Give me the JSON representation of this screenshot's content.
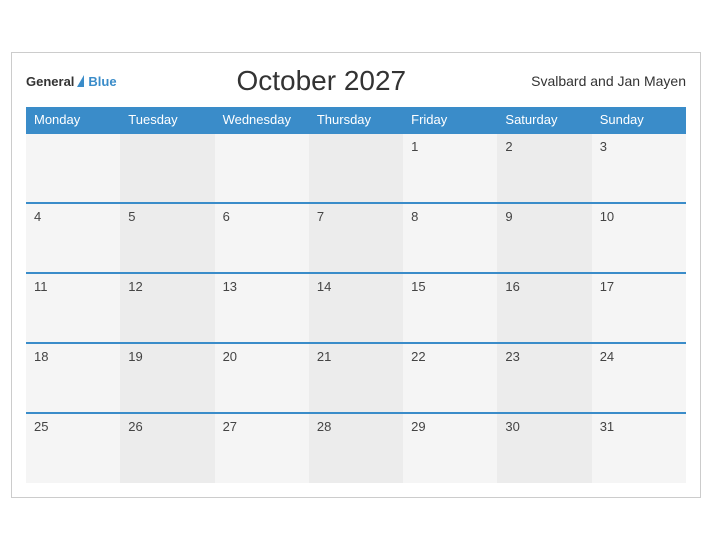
{
  "header": {
    "logo_general": "General",
    "logo_blue": "Blue",
    "title": "October 2027",
    "region": "Svalbard and Jan Mayen"
  },
  "weekdays": [
    "Monday",
    "Tuesday",
    "Wednesday",
    "Thursday",
    "Friday",
    "Saturday",
    "Sunday"
  ],
  "weeks": [
    [
      null,
      null,
      null,
      null,
      "1",
      "2",
      "3"
    ],
    [
      "4",
      "5",
      "6",
      "7",
      "8",
      "9",
      "10"
    ],
    [
      "11",
      "12",
      "13",
      "14",
      "15",
      "16",
      "17"
    ],
    [
      "18",
      "19",
      "20",
      "21",
      "22",
      "23",
      "24"
    ],
    [
      "25",
      "26",
      "27",
      "28",
      "29",
      "30",
      "31"
    ]
  ]
}
